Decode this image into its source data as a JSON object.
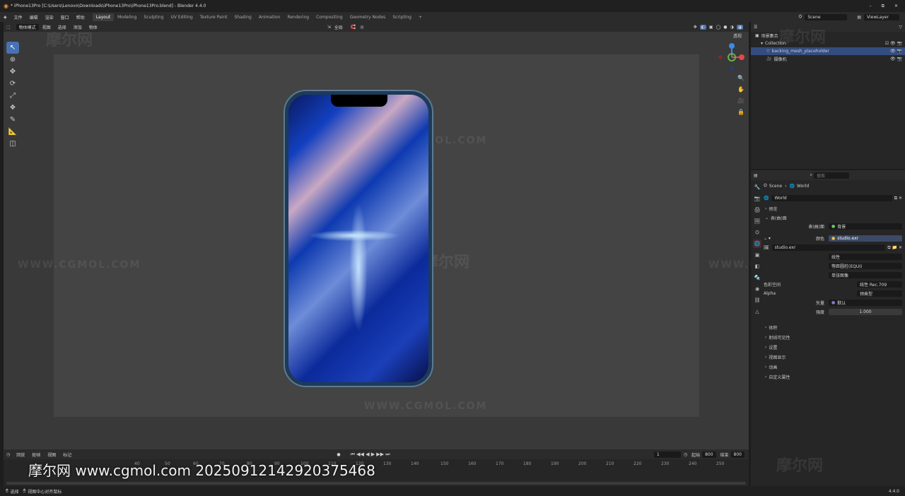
{
  "window": {
    "title": "* iPhone13Pro [C:\\Users\\Lenovo\\Downloads\\iPhone13Pro\\iPhone13Pro.blend] - Blender 4.4.0",
    "controls": [
      "–",
      "⧉",
      "✕"
    ]
  },
  "menu": {
    "items": [
      "文件",
      "编辑",
      "渲染",
      "窗口",
      "帮助"
    ],
    "workspaces": [
      "Layout",
      "Modeling",
      "Sculpting",
      "UV Editing",
      "Texture Paint",
      "Shading",
      "Animation",
      "Rendering",
      "Compositing",
      "Geometry Nodes",
      "Scripting",
      "+"
    ],
    "active_workspace": "Layout",
    "scene": "Scene",
    "view_layer": "ViewLayer"
  },
  "viewport": {
    "header": {
      "mode": "物体模式",
      "menus": [
        "视图",
        "选择",
        "添加",
        "物体"
      ],
      "transform": "全局",
      "overlay_label": "透视"
    },
    "watermark_url": "WWW.CGMOL.COM",
    "watermark_logo": "摩尔网"
  },
  "outliner": {
    "title": "场景集合",
    "collection": "Collection",
    "items": [
      {
        "name": "backing_mesh_placeholder",
        "selected": true
      },
      {
        "name": "摄像机",
        "selected": false
      }
    ]
  },
  "properties": {
    "search_placeholder": "搜索",
    "breadcrumb": [
      "Scene",
      "World"
    ],
    "world_name": "World",
    "sections_top": [
      "预览",
      "表(曲)面"
    ],
    "surface_label": "表(曲)面",
    "surface_value": "背景",
    "color_label": "颜色",
    "color_value": "studio.exr",
    "image_name": "studio.exr",
    "interp": "线性",
    "projection": "等距圆柱(EQUI)",
    "source": "单张图像",
    "colorspace_label": "色彩空间",
    "colorspace_value": "线性 Rec.709",
    "alpha_label": "Alpha",
    "alpha_value": "预乘型",
    "vector_label": "矢量",
    "vector_value": "默认",
    "strength_label": "强度",
    "strength_value": "1.000",
    "sections_bottom": [
      "体积",
      "射线可见性",
      "设置",
      "视图显示",
      "动画",
      "自定义属性"
    ]
  },
  "timeline": {
    "menus": [
      "回放",
      "抠帧",
      "视图",
      "标记"
    ],
    "current_frame": "1",
    "start_label": "起始",
    "start": "800",
    "end_label": "结束",
    "end": "800",
    "ticks": [
      "40",
      "50",
      "60",
      "70",
      "80",
      "90",
      "100",
      "110",
      "120",
      "130",
      "140",
      "150",
      "160",
      "170",
      "180",
      "190",
      "200",
      "210",
      "220",
      "230",
      "240",
      "250"
    ]
  },
  "status": {
    "select": "选择",
    "center": "视图中心对齐鼠标",
    "version": "4.4.0"
  },
  "overlay": {
    "bottom_watermark": "摩尔网 www.cgmol.com 20250912142920375468"
  }
}
